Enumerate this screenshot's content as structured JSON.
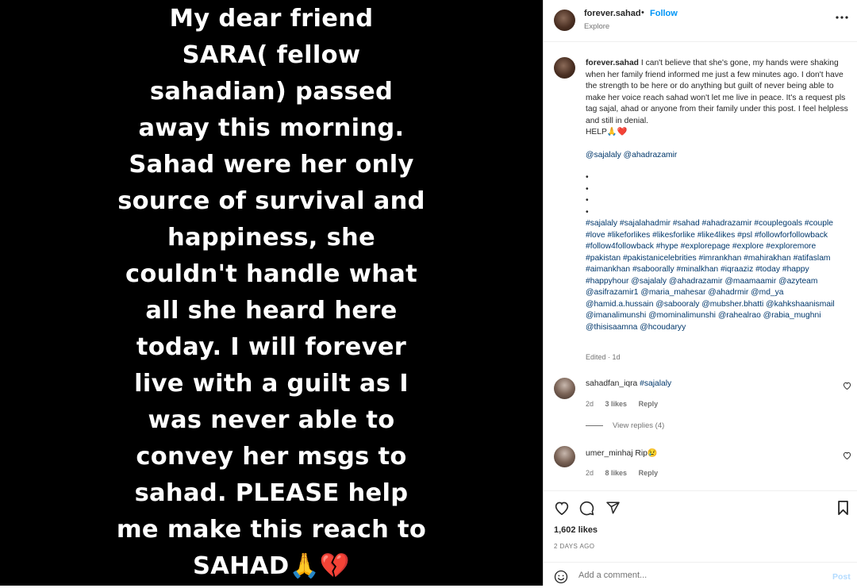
{
  "media": {
    "text": "My dear friend\nSARA( fellow\nsahadian) passed\naway this morning.\nSahad were her only\nsource of survival and\nhappiness, she\ncouldn't handle what\nall she heard here\ntoday. I will forever\nlive with a guilt as I\nwas never able to\nconvey her msgs to\nsahad. PLEASE help\nme make this reach to\nSAHAD🙏💔"
  },
  "header": {
    "username": "forever.sahad",
    "dot": "•",
    "follow_label": "Follow",
    "subtitle": "Explore",
    "more_icon": "more-horizontal-icon"
  },
  "caption": {
    "username": "forever.sahad",
    "text": "I can't believe that she's gone, my hands were shaking when her family friend informed me just a few minutes ago. I don't have the strength to be here or do anything but guilt of never being able to make her voice reach sahad won't let me live in peace. It's a request pls tag sajal, ahad or anyone from their family under this post. I feel helpless and still in denial.\nHELP🙏❤️",
    "mentions": "@sajalaly @ahadrazamir",
    "bullets": "•\n•\n•\n•",
    "hashtags": "#sajalaly #sajalahadmir #sahad #ahadrazamir #couplegoals #couple #love #likeforlikes #likesforlike #like4likes #psl #followforfollowback #follow4followback #hype #explorepage #explore #exploremore #pakistan #pakistanicelebrities #imrankhan #mahirakhan #atifaslam #aimankhan #saboorally #minalkhan #iqraaziz #today #happy #happyhour @sajalaly @ahadrazamir @maamaamir @azyteam @asifrazamir1 @maria_mahesar @ahadrmir @md_ya @hamid.a.hussain @sabooraly @mubsher.bhatti @kahkshaanismail @imanalimunshi @mominalimunshi @rahealrao @rabia_mughni @thisisaamna @hcoudaryy",
    "edited": "Edited · 1d"
  },
  "comments": [
    {
      "username": "sahadfan_iqra",
      "text": "#sajalaly",
      "age": "2d",
      "likes": "3 likes",
      "reply": "Reply"
    },
    {
      "username": "umer_minhaj",
      "text": "Rip😢",
      "age": "2d",
      "likes": "8 likes",
      "reply": "Reply"
    }
  ],
  "view_replies": "View replies (4)",
  "actions": {
    "icons": [
      "heart-icon",
      "comment-icon",
      "share-icon",
      "bookmark-icon"
    ]
  },
  "likes": "1,602 likes",
  "date": "2 DAYS AGO",
  "add_comment": {
    "placeholder": "Add a comment...",
    "post_label": "Post"
  },
  "colors": {
    "accent": "#0095f6",
    "link": "#00376b",
    "muted": "#737373",
    "post_disabled": "#b3dbff"
  }
}
